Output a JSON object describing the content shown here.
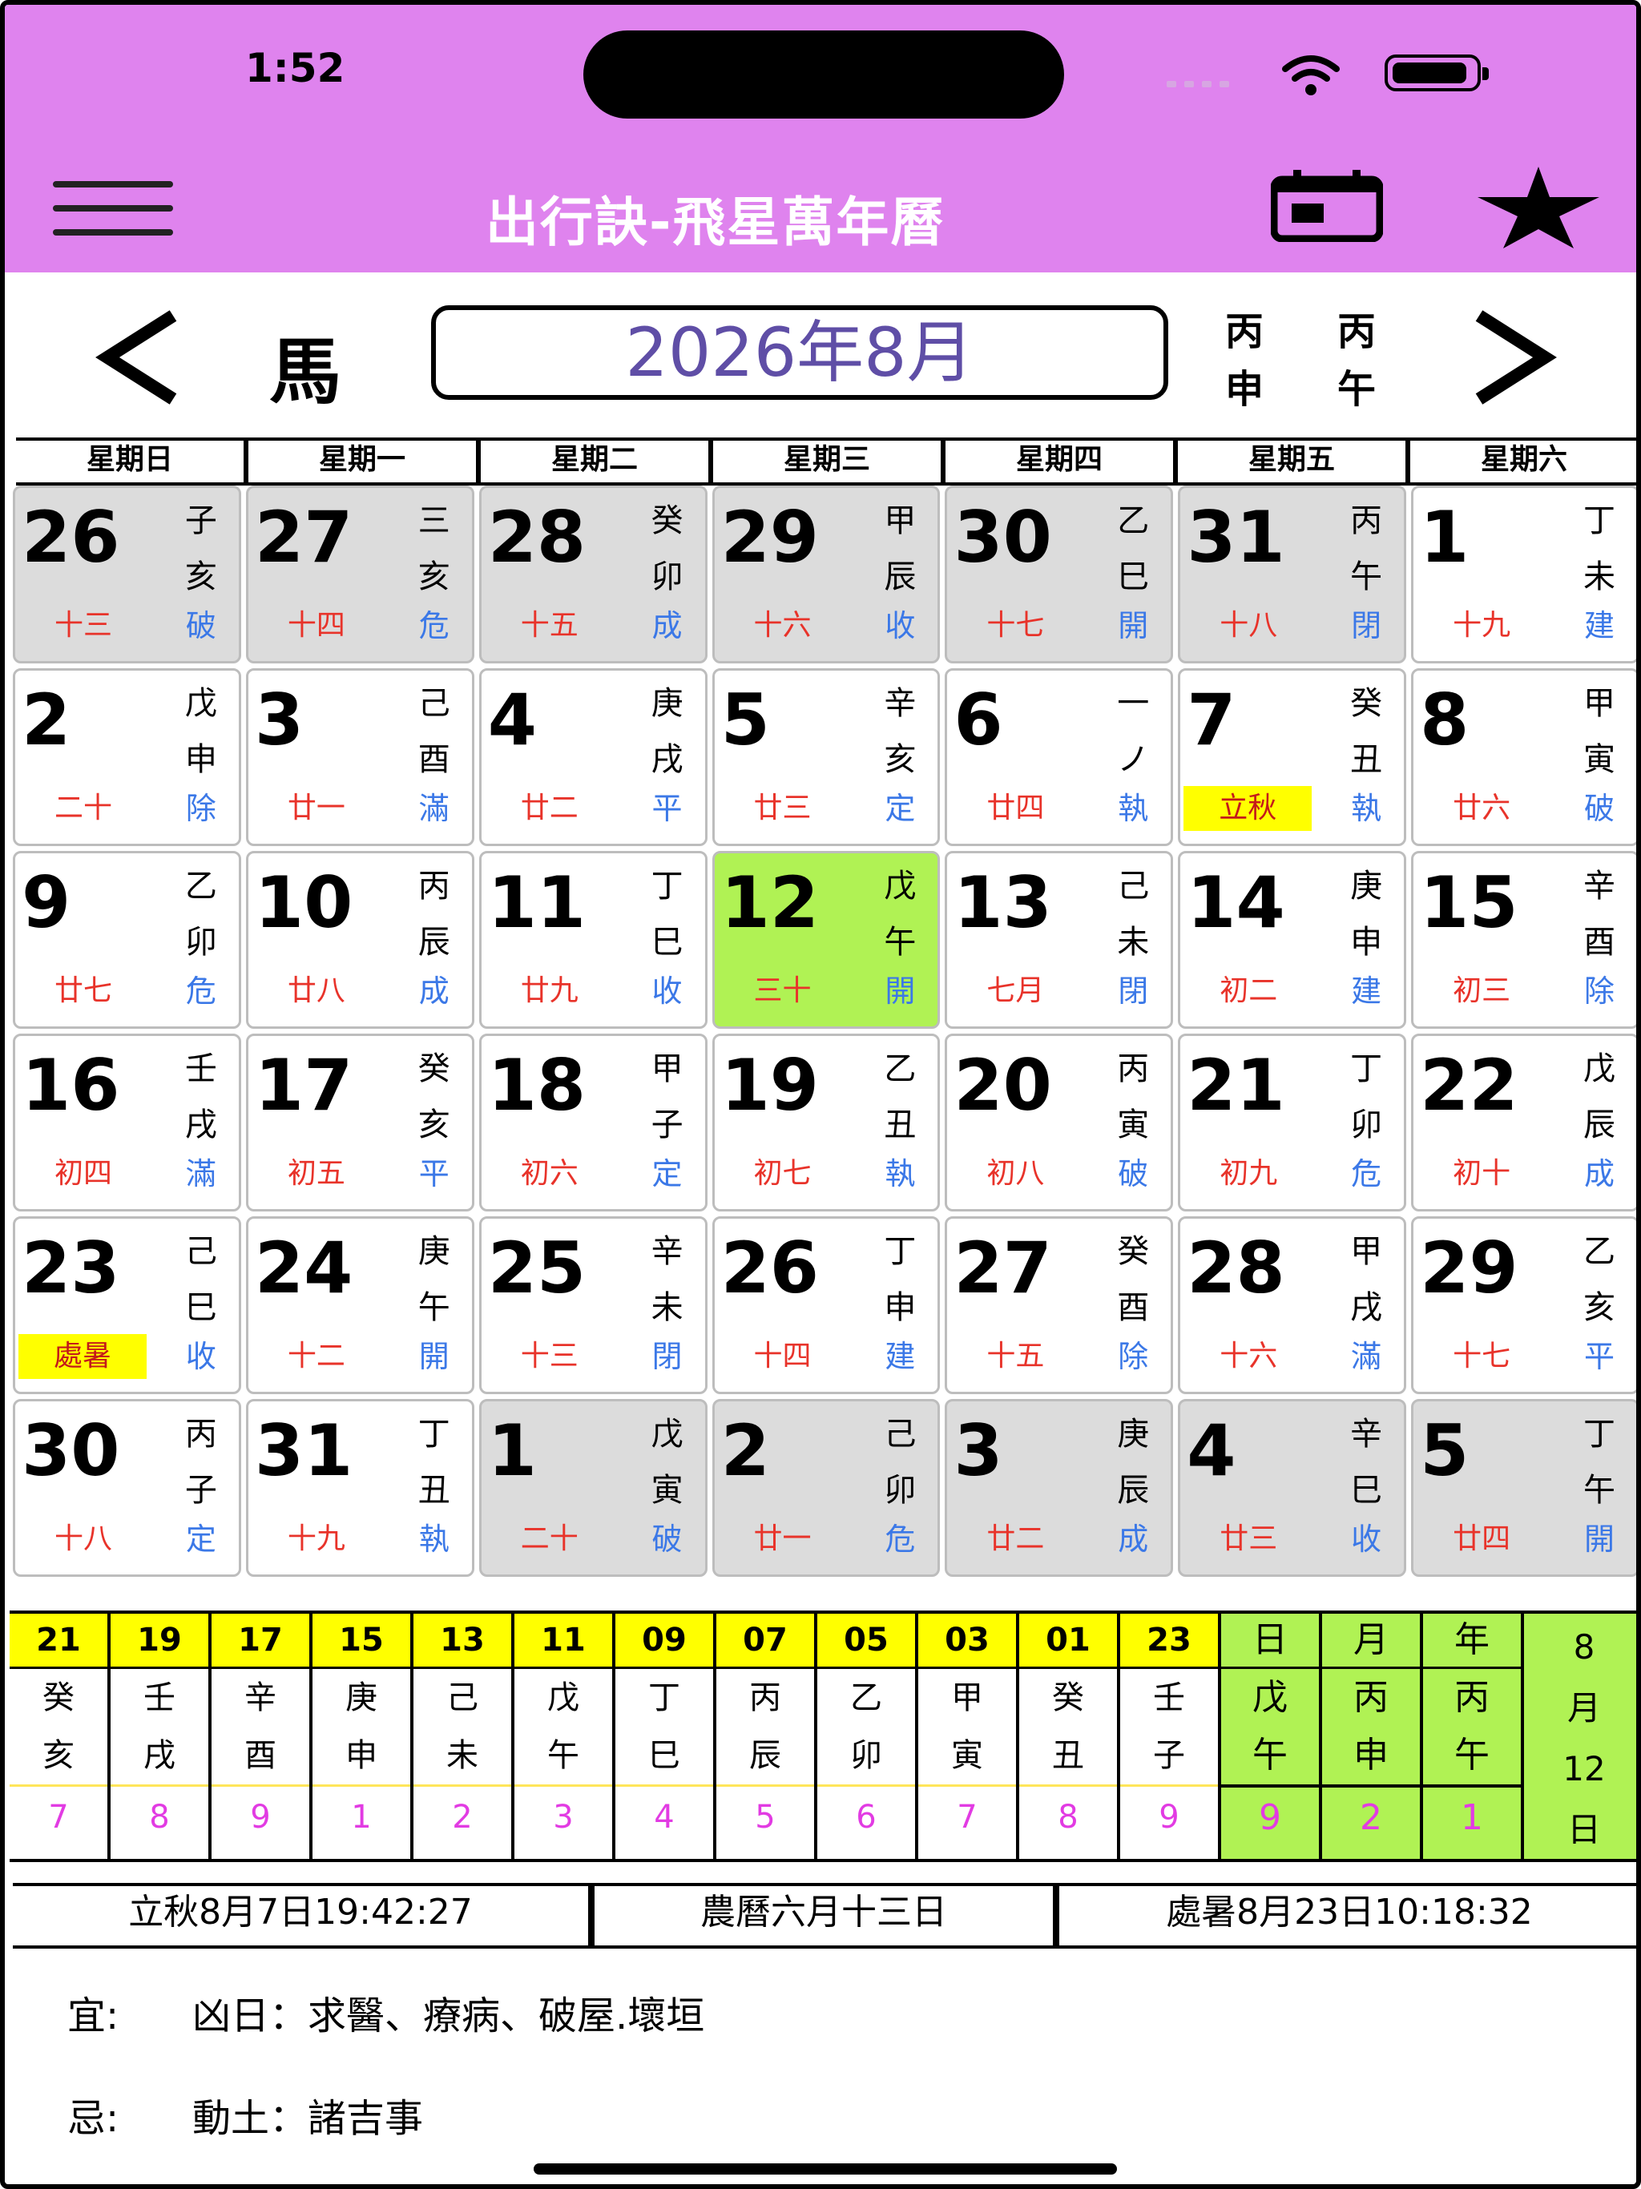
{
  "status": {
    "time": "1:52"
  },
  "header": {
    "title": "出行訣-飛星萬年曆",
    "icons": [
      "menu-icon",
      "calendar-icon",
      "star-icon"
    ]
  },
  "nav": {
    "zodiac": "馬",
    "month_label": "2026年8月",
    "ganzhi": {
      "month": [
        "丙",
        "申"
      ],
      "year": [
        "丙",
        "午"
      ]
    }
  },
  "weekdays": [
    "星期日",
    "星期一",
    "星期二",
    "星期三",
    "星期四",
    "星期五",
    "星期六"
  ],
  "calendar": {
    "cells": [
      {
        "d": "26",
        "gz": [
          "子",
          "亥"
        ],
        "lunar": "十三",
        "officer": "破",
        "other": true
      },
      {
        "d": "27",
        "gz": [
          "三",
          "亥"
        ],
        "lunar": "十四",
        "officer": "危",
        "other": true
      },
      {
        "d": "28",
        "gz": [
          "癸",
          "卯"
        ],
        "lunar": "十五",
        "officer": "成",
        "other": true
      },
      {
        "d": "29",
        "gz": [
          "甲",
          "辰"
        ],
        "lunar": "十六",
        "officer": "收",
        "other": true
      },
      {
        "d": "30",
        "gz": [
          "乙",
          "巳"
        ],
        "lunar": "十七",
        "officer": "開",
        "other": true
      },
      {
        "d": "31",
        "gz": [
          "丙",
          "午"
        ],
        "lunar": "十八",
        "officer": "閉",
        "other": true
      },
      {
        "d": "1",
        "gz": [
          "丁",
          "未"
        ],
        "lunar": "十九",
        "officer": "建"
      },
      {
        "d": "2",
        "gz": [
          "戊",
          "申"
        ],
        "lunar": "二十",
        "officer": "除"
      },
      {
        "d": "3",
        "gz": [
          "己",
          "酉"
        ],
        "lunar": "廿一",
        "officer": "滿"
      },
      {
        "d": "4",
        "gz": [
          "庚",
          "戌"
        ],
        "lunar": "廿二",
        "officer": "平"
      },
      {
        "d": "5",
        "gz": [
          "辛",
          "亥"
        ],
        "lunar": "廿三",
        "officer": "定"
      },
      {
        "d": "6",
        "gz": [
          "一",
          "ノ"
        ],
        "lunar": "廿四",
        "officer": "執"
      },
      {
        "d": "7",
        "gz": [
          "癸",
          "丑"
        ],
        "lunar": "立秋",
        "officer": "執",
        "term": true
      },
      {
        "d": "8",
        "gz": [
          "甲",
          "寅"
        ],
        "lunar": "廿六",
        "officer": "破"
      },
      {
        "d": "9",
        "gz": [
          "乙",
          "卯"
        ],
        "lunar": "廿七",
        "officer": "危"
      },
      {
        "d": "10",
        "gz": [
          "丙",
          "辰"
        ],
        "lunar": "廿八",
        "officer": "成"
      },
      {
        "d": "11",
        "gz": [
          "丁",
          "巳"
        ],
        "lunar": "廿九",
        "officer": "收"
      },
      {
        "d": "12",
        "gz": [
          "戊",
          "午"
        ],
        "lunar": "三十",
        "officer": "開",
        "today": true
      },
      {
        "d": "13",
        "gz": [
          "己",
          "未"
        ],
        "lunar": "七月",
        "officer": "閉"
      },
      {
        "d": "14",
        "gz": [
          "庚",
          "申"
        ],
        "lunar": "初二",
        "officer": "建"
      },
      {
        "d": "15",
        "gz": [
          "辛",
          "酉"
        ],
        "lunar": "初三",
        "officer": "除"
      },
      {
        "d": "16",
        "gz": [
          "壬",
          "戌"
        ],
        "lunar": "初四",
        "officer": "滿"
      },
      {
        "d": "17",
        "gz": [
          "癸",
          "亥"
        ],
        "lunar": "初五",
        "officer": "平"
      },
      {
        "d": "18",
        "gz": [
          "甲",
          "子"
        ],
        "lunar": "初六",
        "officer": "定"
      },
      {
        "d": "19",
        "gz": [
          "乙",
          "丑"
        ],
        "lunar": "初七",
        "officer": "執"
      },
      {
        "d": "20",
        "gz": [
          "丙",
          "寅"
        ],
        "lunar": "初八",
        "officer": "破"
      },
      {
        "d": "21",
        "gz": [
          "丁",
          "卯"
        ],
        "lunar": "初九",
        "officer": "危"
      },
      {
        "d": "22",
        "gz": [
          "戊",
          "辰"
        ],
        "lunar": "初十",
        "officer": "成"
      },
      {
        "d": "23",
        "gz": [
          "己",
          "巳"
        ],
        "lunar": "處暑",
        "officer": "收",
        "term": true
      },
      {
        "d": "24",
        "gz": [
          "庚",
          "午"
        ],
        "lunar": "十二",
        "officer": "開"
      },
      {
        "d": "25",
        "gz": [
          "辛",
          "未"
        ],
        "lunar": "十三",
        "officer": "閉"
      },
      {
        "d": "26",
        "gz": [
          "丁",
          "申"
        ],
        "lunar": "十四",
        "officer": "建"
      },
      {
        "d": "27",
        "gz": [
          "癸",
          "酉"
        ],
        "lunar": "十五",
        "officer": "除"
      },
      {
        "d": "28",
        "gz": [
          "甲",
          "戌"
        ],
        "lunar": "十六",
        "officer": "滿"
      },
      {
        "d": "29",
        "gz": [
          "乙",
          "亥"
        ],
        "lunar": "十七",
        "officer": "平"
      },
      {
        "d": "30",
        "gz": [
          "丙",
          "子"
        ],
        "lunar": "十八",
        "officer": "定"
      },
      {
        "d": "31",
        "gz": [
          "丁",
          "丑"
        ],
        "lunar": "十九",
        "officer": "執"
      },
      {
        "d": "1",
        "gz": [
          "戊",
          "寅"
        ],
        "lunar": "二十",
        "officer": "破",
        "other": true
      },
      {
        "d": "2",
        "gz": [
          "己",
          "卯"
        ],
        "lunar": "廿一",
        "officer": "危",
        "other": true
      },
      {
        "d": "3",
        "gz": [
          "庚",
          "辰"
        ],
        "lunar": "廿二",
        "officer": "成",
        "other": true
      },
      {
        "d": "4",
        "gz": [
          "辛",
          "巳"
        ],
        "lunar": "廿三",
        "officer": "收",
        "other": true
      },
      {
        "d": "5",
        "gz": [
          "丁",
          "午"
        ],
        "lunar": "廿四",
        "officer": "開",
        "other": true
      }
    ]
  },
  "hours": [
    {
      "hour": "21",
      "g1": "癸",
      "g2": "亥",
      "star": "7"
    },
    {
      "hour": "19",
      "g1": "壬",
      "g2": "戌",
      "star": "8"
    },
    {
      "hour": "17",
      "g1": "辛",
      "g2": "酉",
      "star": "9"
    },
    {
      "hour": "15",
      "g1": "庚",
      "g2": "申",
      "star": "1"
    },
    {
      "hour": "13",
      "g1": "己",
      "g2": "未",
      "star": "2"
    },
    {
      "hour": "11",
      "g1": "戊",
      "g2": "午",
      "star": "3"
    },
    {
      "hour": "09",
      "g1": "丁",
      "g2": "巳",
      "star": "4"
    },
    {
      "hour": "07",
      "g1": "丙",
      "g2": "辰",
      "star": "5"
    },
    {
      "hour": "05",
      "g1": "乙",
      "g2": "卯",
      "star": "6"
    },
    {
      "hour": "03",
      "g1": "甲",
      "g2": "寅",
      "star": "7"
    },
    {
      "hour": "01",
      "g1": "癸",
      "g2": "丑",
      "star": "8"
    },
    {
      "hour": "23",
      "g1": "壬",
      "g2": "子",
      "star": "9"
    }
  ],
  "ganzhi_summary": [
    {
      "label": "日",
      "g1": "戊",
      "g2": "午",
      "star": "9"
    },
    {
      "label": "月",
      "g1": "丙",
      "g2": "申",
      "star": "2"
    },
    {
      "label": "年",
      "g1": "丙",
      "g2": "午",
      "star": "1"
    }
  ],
  "date_box": [
    "8",
    "月",
    "12",
    "日"
  ],
  "info": {
    "solar_term": "立秋8月7日19:42:27",
    "lunar_date": "農曆六月十三日",
    "next_term": "處暑8月23日10:18:32"
  },
  "yi": {
    "label": "宜:",
    "text": "凶日：求醫、療病、破屋.壞垣"
  },
  "ji": {
    "label": "忌:",
    "text": "動土：諸吉事"
  },
  "colors": {
    "header": "#df83ee",
    "today": "#b0f254",
    "term_highlight": "#ffff00",
    "lunar_text": "#e8332a",
    "officer_text": "#3b78e7",
    "star_text": "#e23be3",
    "other_month": "#dcdcdc"
  }
}
